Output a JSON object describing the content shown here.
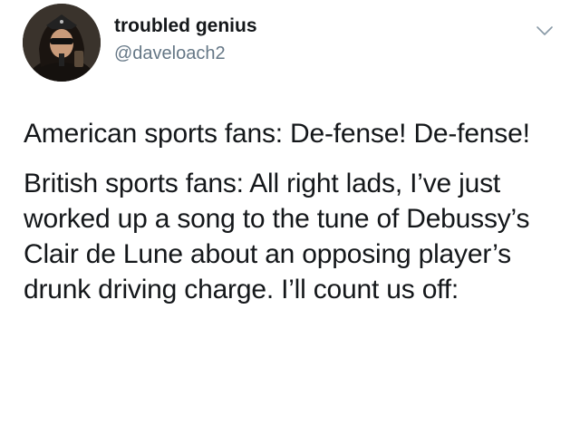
{
  "tweet": {
    "user": {
      "display_name": "troubled genius",
      "handle": "@daveloach2"
    },
    "menu_icon": "chevron-down-icon",
    "avatar_icon": "avatar-photo",
    "paragraphs": [
      "American sports fans: De-fense! De-fense!",
      "British sports fans: All right lads, I’ve just worked up a song to the tune of Debussy’s Clair de Lune about an opposing player’s drunk driving charge. I’ll count us off:"
    ]
  },
  "colors": {
    "text": "#14171a",
    "secondary_text": "#657786",
    "background": "#ffffff",
    "chevron": "#8899a6"
  }
}
